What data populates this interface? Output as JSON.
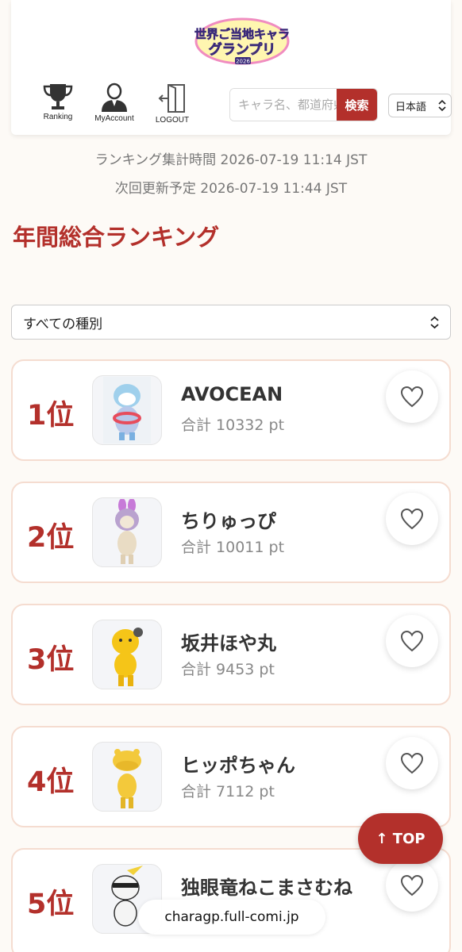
{
  "header": {
    "logo_text_line1": "世界ご当地キャラ",
    "logo_text_line2": "グランプリ",
    "logo_year": "2026",
    "nav": [
      {
        "label": "Ranking",
        "icon": "trophy-icon"
      },
      {
        "label": "MyAccount",
        "icon": "user-icon"
      },
      {
        "label": "LOGOUT",
        "icon": "logout-icon"
      }
    ],
    "search_placeholder": "キャラ名、都道府県",
    "search_button": "検索",
    "language": "日本語"
  },
  "status": {
    "aggregated_label": "ランキング集計時間",
    "aggregated_time": "2026-07-19 11:14 JST",
    "next_update_label": "次回更新予定",
    "next_update_time": "2026-07-19 11:44 JST"
  },
  "page_title": "年間総合ランキング",
  "filter": {
    "selected": "すべての種別"
  },
  "rankings": [
    {
      "rank": "1位",
      "name": "AVOCEAN",
      "points": "合計 10332 pt"
    },
    {
      "rank": "2位",
      "name": "ちりゅっぴ",
      "points": "合計 10011 pt"
    },
    {
      "rank": "3位",
      "name": "坂井ほや丸",
      "points": "合計 9453 pt"
    },
    {
      "rank": "4位",
      "name": "ヒッポちゃん",
      "points": "合計 7112 pt"
    },
    {
      "rank": "5位",
      "name": "独眼竜ねこまさむね",
      "points": ""
    }
  ],
  "top_button": "↑ TOP",
  "url": "charagp.full-comi.jp",
  "colors": {
    "accent": "#b3302b",
    "card_border": "#f5dcd0"
  }
}
